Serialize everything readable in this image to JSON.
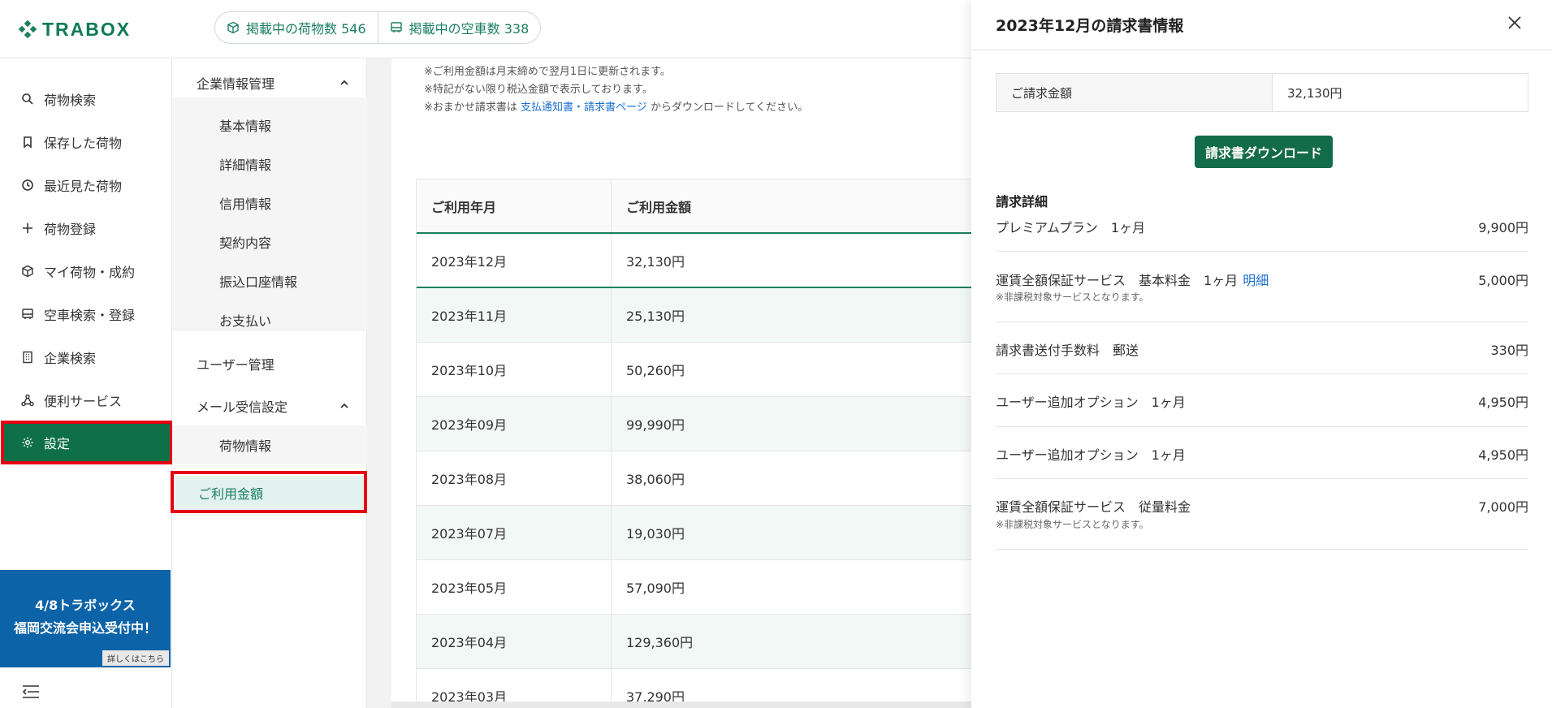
{
  "header": {
    "logo": "TRABOX",
    "stats": [
      {
        "icon": "package-icon",
        "label": "掲載中の荷物数 546"
      },
      {
        "icon": "truck-icon",
        "label": "掲載中の空車数 338"
      }
    ]
  },
  "sidebar": {
    "items": [
      {
        "icon": "search-icon",
        "label": "荷物検索"
      },
      {
        "icon": "bookmark-icon",
        "label": "保存した荷物"
      },
      {
        "icon": "history-icon",
        "label": "最近見た荷物"
      },
      {
        "icon": "plus-icon",
        "label": "荷物登録"
      },
      {
        "icon": "package-icon",
        "label": "マイ荷物・成約"
      },
      {
        "icon": "truck-icon",
        "label": "空車検索・登録"
      },
      {
        "icon": "building-icon",
        "label": "企業検索"
      },
      {
        "icon": "network-icon",
        "label": "便利サービス"
      },
      {
        "icon": "gear-icon",
        "label": "設定"
      }
    ],
    "banner": {
      "line1": "4/8トラボックス",
      "line2": "福岡交流会申込受付中！",
      "more": "詳しくはこちら"
    }
  },
  "submenu": {
    "group1": {
      "title": "企業情報管理",
      "items": [
        "基本情報",
        "詳細情報",
        "信用情報",
        "契約内容",
        "振込口座情報",
        "お支払い"
      ]
    },
    "user": "ユーザー管理",
    "group2": {
      "title": "メール受信設定",
      "items": [
        "荷物情報"
      ]
    },
    "active": "ご利用金額"
  },
  "main": {
    "notes": {
      "line1": "※ご利用金額は月末締めで翌月1日に更新されます。",
      "line2": "※特記がない限り税込金額で表示しております。",
      "line3_pre": "※おまかせ請求書は ",
      "line3_link": "支払通知書・請求書ページ",
      "line3_post": " からダウンロードしてください。"
    },
    "table": {
      "headers": [
        "ご利用年月",
        "ご利用金額"
      ],
      "rows": [
        [
          "2023年12月",
          "32,130円"
        ],
        [
          "2023年11月",
          "25,130円"
        ],
        [
          "2023年10月",
          "50,260円"
        ],
        [
          "2023年09月",
          "99,990円"
        ],
        [
          "2023年08月",
          "38,060円"
        ],
        [
          "2023年07月",
          "19,030円"
        ],
        [
          "2023年05月",
          "57,090円"
        ],
        [
          "2023年04月",
          "129,360円"
        ],
        [
          "2023年03月",
          "37,290円"
        ]
      ]
    }
  },
  "drawer": {
    "title": "2023年12月の請求書情報",
    "amount_label": "ご請求金額",
    "amount_value": "32,130円",
    "download": "請求書ダウンロード",
    "detail_title": "請求詳細",
    "lines": [
      {
        "name": "プレミアムプラン　1ヶ月",
        "price": "9,900円",
        "sub": "",
        "link": ""
      },
      {
        "name": "運賃全額保証サービス　基本料金　1ヶ月",
        "price": "5,000円",
        "sub": "※非課税対象サービスとなります。",
        "link": "明細"
      },
      {
        "name": "請求書送付手数料　郵送",
        "price": "330円",
        "sub": "",
        "link": ""
      },
      {
        "name": "ユーザー追加オプション　1ヶ月",
        "price": "4,950円",
        "sub": "",
        "link": ""
      },
      {
        "name": "ユーザー追加オプション　1ヶ月",
        "price": "4,950円",
        "sub": "",
        "link": ""
      },
      {
        "name": "運賃全額保証サービス　従量料金",
        "price": "7,000円",
        "sub": "※非課税対象サービスとなります。",
        "link": ""
      }
    ]
  }
}
